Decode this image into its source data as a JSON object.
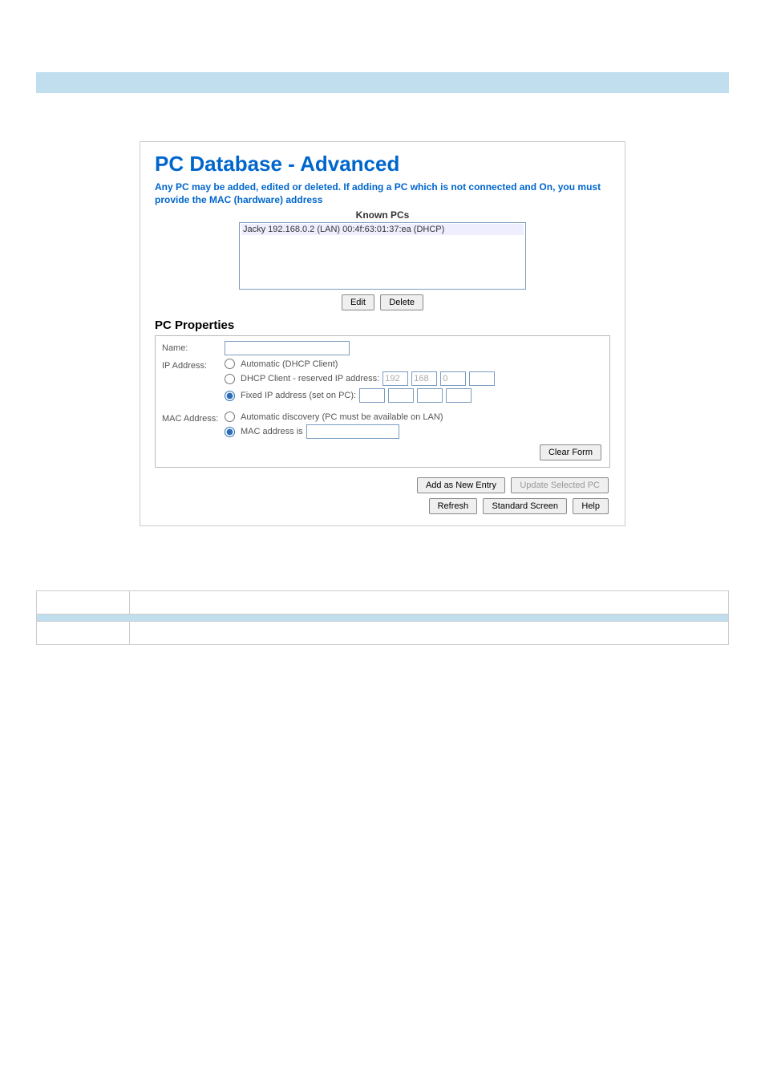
{
  "topbar": {
    "text": ""
  },
  "screen": {
    "title": "PC Database - Advanced",
    "description": "Any PC may be added, edited or deleted. If adding a PC which is not connected and On, you must provide the MAC (hardware) address",
    "known_pcs_label": "Known PCs",
    "known_pcs_items": [
      "Jacky 192.168.0.2 (LAN) 00:4f:63:01:37:ea (DHCP)"
    ],
    "buttons": {
      "edit": "Edit",
      "delete": "Delete",
      "clear_form": "Clear Form",
      "add_new": "Add as New Entry",
      "update": "Update Selected PC",
      "refresh": "Refresh",
      "standard": "Standard Screen",
      "help": "Help"
    },
    "props": {
      "heading": "PC Properties",
      "name_label": "Name:",
      "name_value": "",
      "ip_label": "IP Address:",
      "ip_opts": {
        "auto": "Automatic (DHCP Client)",
        "reserved_prefix": "DHCP Client - reserved IP address:",
        "reserved_octets": [
          "192",
          "168",
          "0",
          ""
        ],
        "fixed": "Fixed IP address (set on PC):",
        "fixed_octets": [
          "",
          "",
          "",
          ""
        ]
      },
      "mac_label": "MAC Address:",
      "mac_opts": {
        "auto": "Automatic discovery (PC must be available on LAN)",
        "manual": "MAC address is",
        "manual_value": ""
      }
    }
  },
  "table": {
    "r1c1": "",
    "r1c2": "",
    "hdr": "",
    "r3c1": "",
    "r3c2": ""
  }
}
